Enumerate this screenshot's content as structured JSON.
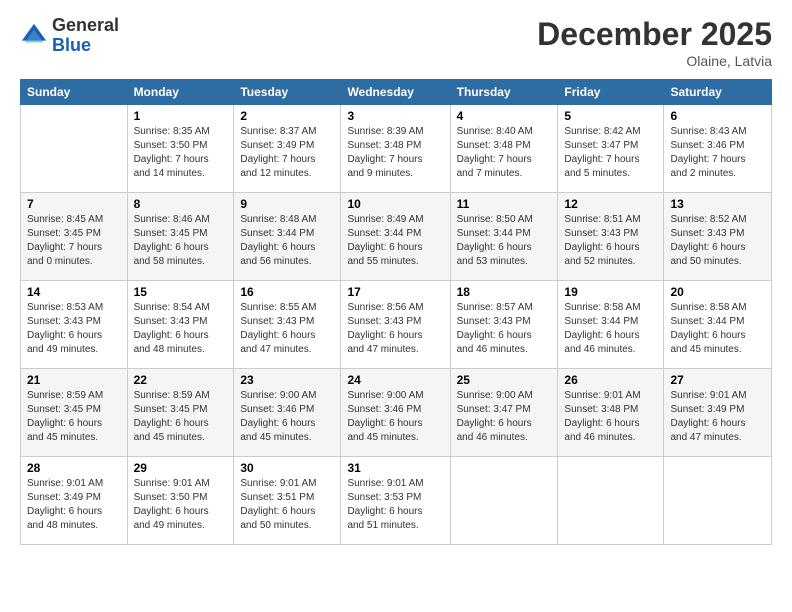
{
  "header": {
    "logo_line1": "General",
    "logo_line2": "Blue",
    "title": "December 2025",
    "location": "Olaine, Latvia"
  },
  "days_of_week": [
    "Sunday",
    "Monday",
    "Tuesday",
    "Wednesday",
    "Thursday",
    "Friday",
    "Saturday"
  ],
  "weeks": [
    [
      {
        "day": "",
        "info": ""
      },
      {
        "day": "1",
        "info": "Sunrise: 8:35 AM\nSunset: 3:50 PM\nDaylight: 7 hours\nand 14 minutes."
      },
      {
        "day": "2",
        "info": "Sunrise: 8:37 AM\nSunset: 3:49 PM\nDaylight: 7 hours\nand 12 minutes."
      },
      {
        "day": "3",
        "info": "Sunrise: 8:39 AM\nSunset: 3:48 PM\nDaylight: 7 hours\nand 9 minutes."
      },
      {
        "day": "4",
        "info": "Sunrise: 8:40 AM\nSunset: 3:48 PM\nDaylight: 7 hours\nand 7 minutes."
      },
      {
        "day": "5",
        "info": "Sunrise: 8:42 AM\nSunset: 3:47 PM\nDaylight: 7 hours\nand 5 minutes."
      },
      {
        "day": "6",
        "info": "Sunrise: 8:43 AM\nSunset: 3:46 PM\nDaylight: 7 hours\nand 2 minutes."
      }
    ],
    [
      {
        "day": "7",
        "info": "Sunrise: 8:45 AM\nSunset: 3:45 PM\nDaylight: 7 hours\nand 0 minutes."
      },
      {
        "day": "8",
        "info": "Sunrise: 8:46 AM\nSunset: 3:45 PM\nDaylight: 6 hours\nand 58 minutes."
      },
      {
        "day": "9",
        "info": "Sunrise: 8:48 AM\nSunset: 3:44 PM\nDaylight: 6 hours\nand 56 minutes."
      },
      {
        "day": "10",
        "info": "Sunrise: 8:49 AM\nSunset: 3:44 PM\nDaylight: 6 hours\nand 55 minutes."
      },
      {
        "day": "11",
        "info": "Sunrise: 8:50 AM\nSunset: 3:44 PM\nDaylight: 6 hours\nand 53 minutes."
      },
      {
        "day": "12",
        "info": "Sunrise: 8:51 AM\nSunset: 3:43 PM\nDaylight: 6 hours\nand 52 minutes."
      },
      {
        "day": "13",
        "info": "Sunrise: 8:52 AM\nSunset: 3:43 PM\nDaylight: 6 hours\nand 50 minutes."
      }
    ],
    [
      {
        "day": "14",
        "info": "Sunrise: 8:53 AM\nSunset: 3:43 PM\nDaylight: 6 hours\nand 49 minutes."
      },
      {
        "day": "15",
        "info": "Sunrise: 8:54 AM\nSunset: 3:43 PM\nDaylight: 6 hours\nand 48 minutes."
      },
      {
        "day": "16",
        "info": "Sunrise: 8:55 AM\nSunset: 3:43 PM\nDaylight: 6 hours\nand 47 minutes."
      },
      {
        "day": "17",
        "info": "Sunrise: 8:56 AM\nSunset: 3:43 PM\nDaylight: 6 hours\nand 47 minutes."
      },
      {
        "day": "18",
        "info": "Sunrise: 8:57 AM\nSunset: 3:43 PM\nDaylight: 6 hours\nand 46 minutes."
      },
      {
        "day": "19",
        "info": "Sunrise: 8:58 AM\nSunset: 3:44 PM\nDaylight: 6 hours\nand 46 minutes."
      },
      {
        "day": "20",
        "info": "Sunrise: 8:58 AM\nSunset: 3:44 PM\nDaylight: 6 hours\nand 45 minutes."
      }
    ],
    [
      {
        "day": "21",
        "info": "Sunrise: 8:59 AM\nSunset: 3:45 PM\nDaylight: 6 hours\nand 45 minutes."
      },
      {
        "day": "22",
        "info": "Sunrise: 8:59 AM\nSunset: 3:45 PM\nDaylight: 6 hours\nand 45 minutes."
      },
      {
        "day": "23",
        "info": "Sunrise: 9:00 AM\nSunset: 3:46 PM\nDaylight: 6 hours\nand 45 minutes."
      },
      {
        "day": "24",
        "info": "Sunrise: 9:00 AM\nSunset: 3:46 PM\nDaylight: 6 hours\nand 45 minutes."
      },
      {
        "day": "25",
        "info": "Sunrise: 9:00 AM\nSunset: 3:47 PM\nDaylight: 6 hours\nand 46 minutes."
      },
      {
        "day": "26",
        "info": "Sunrise: 9:01 AM\nSunset: 3:48 PM\nDaylight: 6 hours\nand 46 minutes."
      },
      {
        "day": "27",
        "info": "Sunrise: 9:01 AM\nSunset: 3:49 PM\nDaylight: 6 hours\nand 47 minutes."
      }
    ],
    [
      {
        "day": "28",
        "info": "Sunrise: 9:01 AM\nSunset: 3:49 PM\nDaylight: 6 hours\nand 48 minutes."
      },
      {
        "day": "29",
        "info": "Sunrise: 9:01 AM\nSunset: 3:50 PM\nDaylight: 6 hours\nand 49 minutes."
      },
      {
        "day": "30",
        "info": "Sunrise: 9:01 AM\nSunset: 3:51 PM\nDaylight: 6 hours\nand 50 minutes."
      },
      {
        "day": "31",
        "info": "Sunrise: 9:01 AM\nSunset: 3:53 PM\nDaylight: 6 hours\nand 51 minutes."
      },
      {
        "day": "",
        "info": ""
      },
      {
        "day": "",
        "info": ""
      },
      {
        "day": "",
        "info": ""
      }
    ]
  ]
}
